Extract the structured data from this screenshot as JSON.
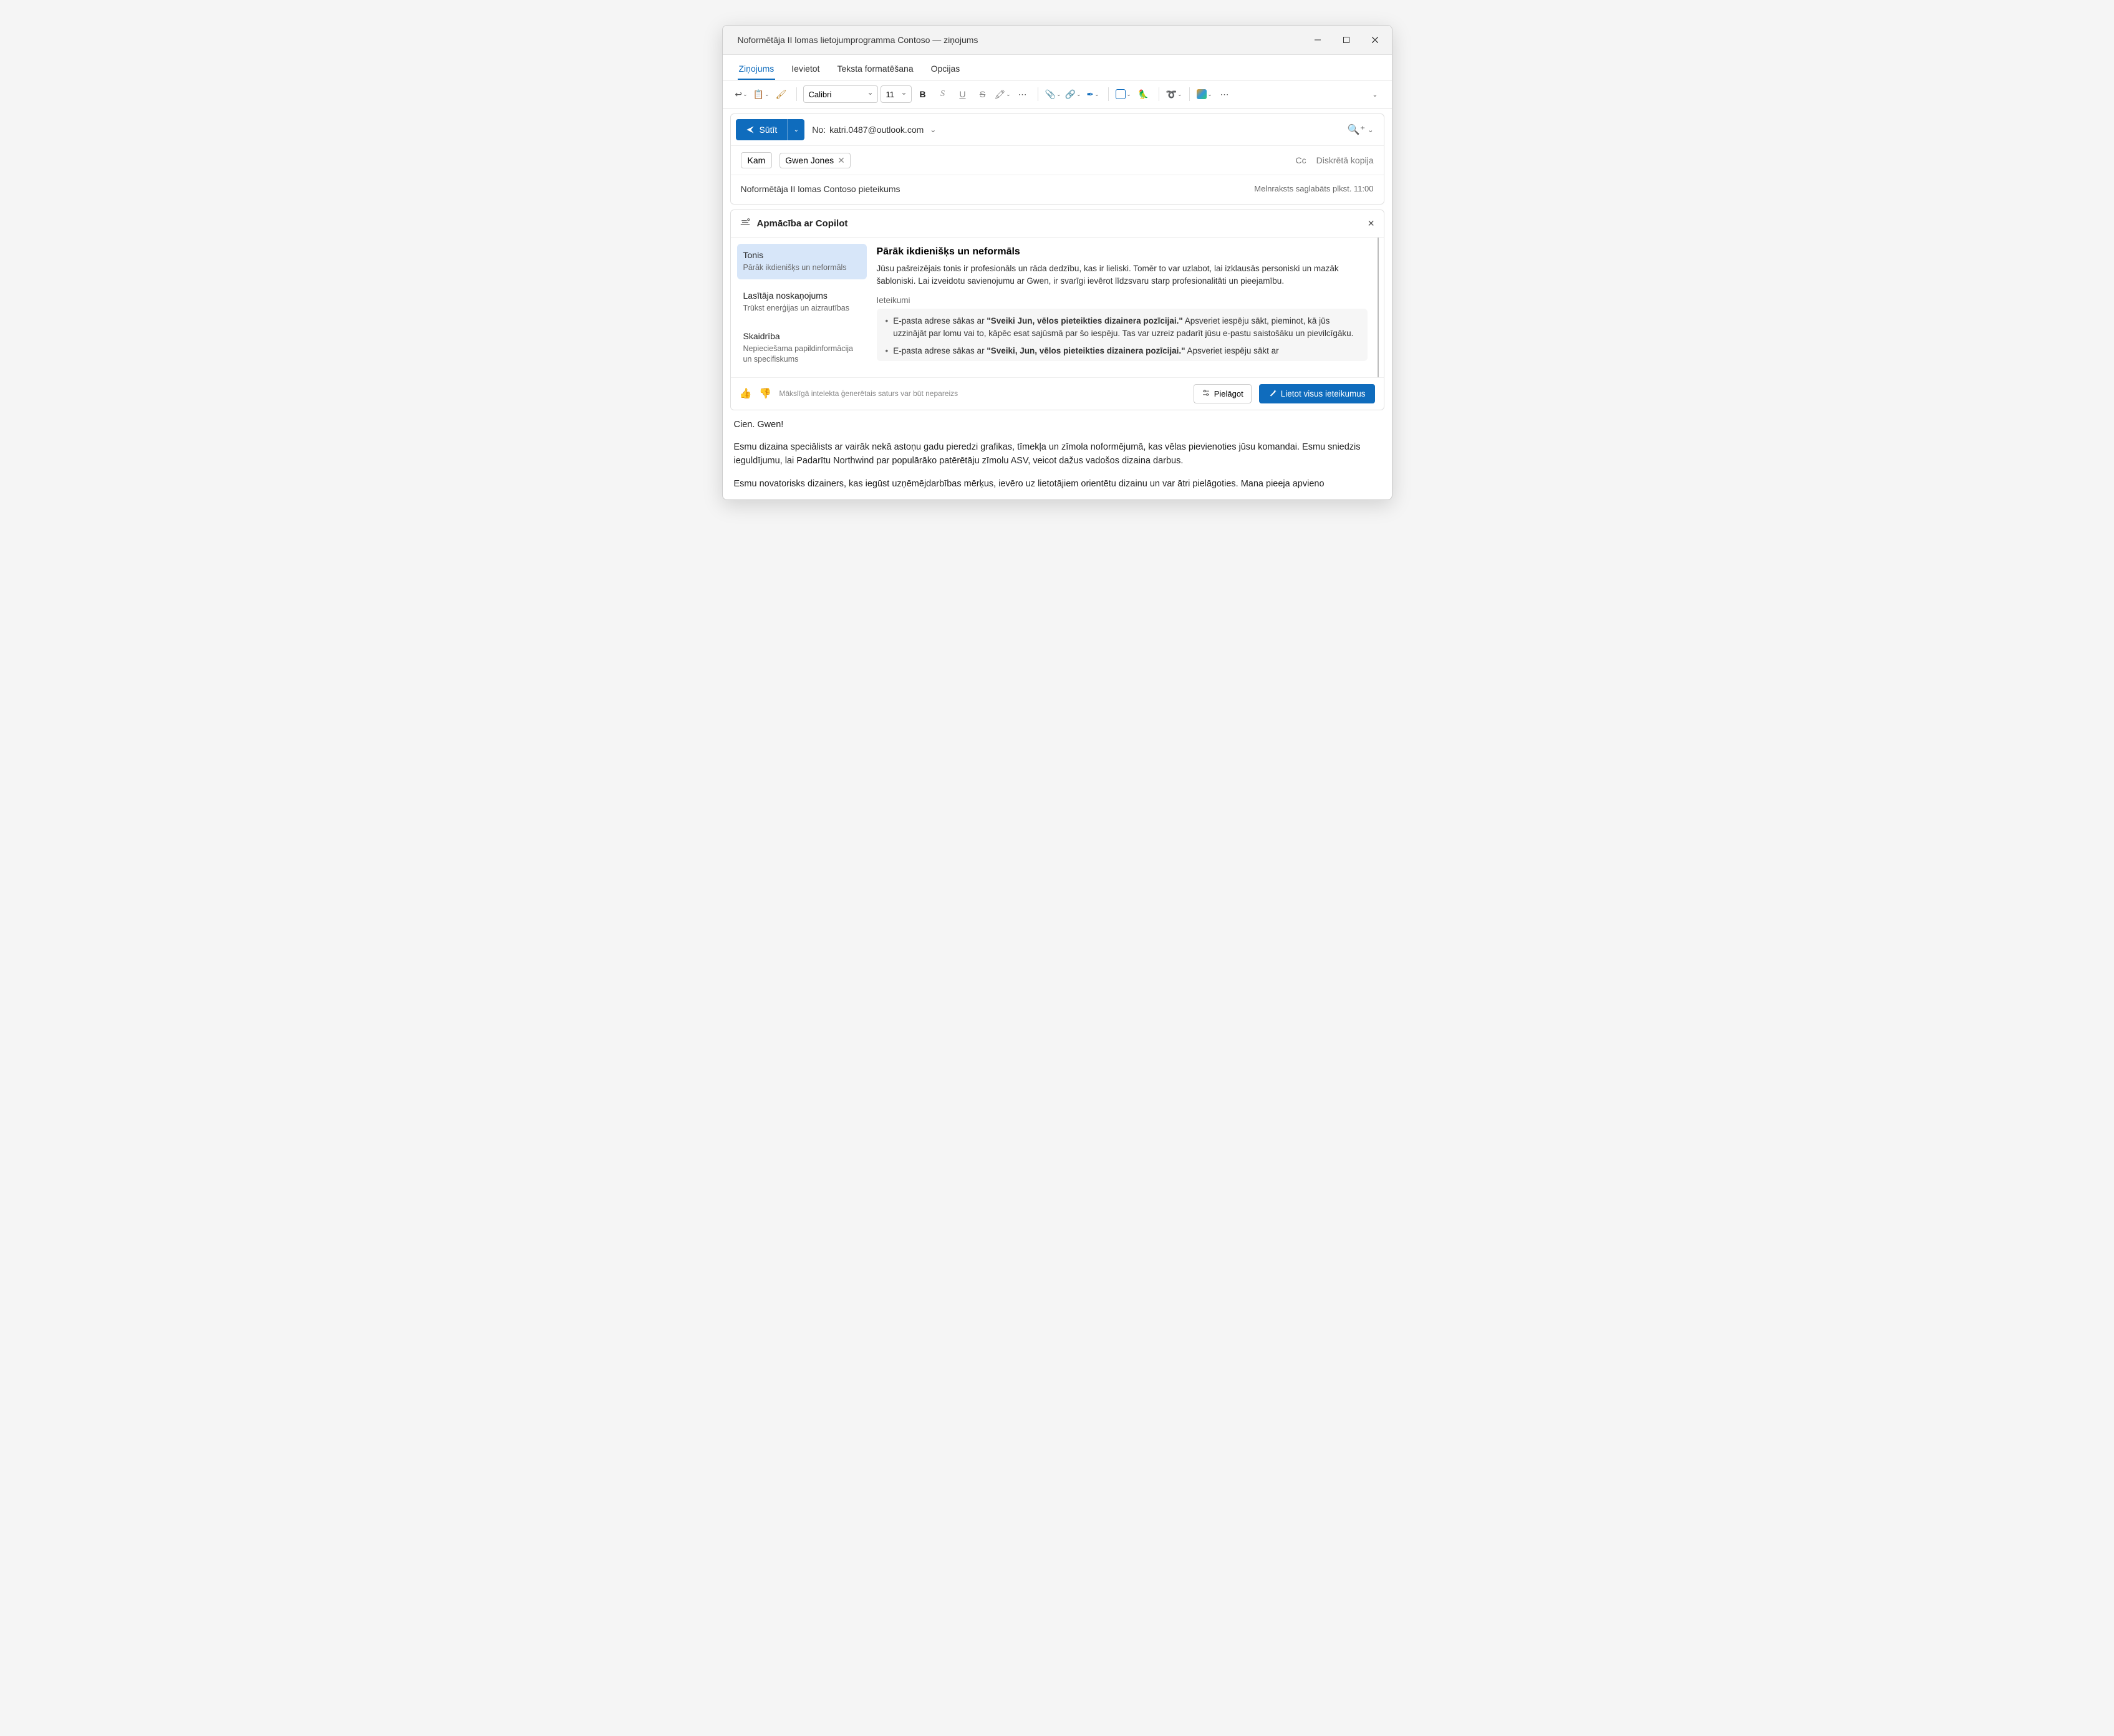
{
  "window": {
    "title": "Noformētāja II lomas lietojumprogramma Contoso — ziņojums"
  },
  "tabs": {
    "message": "Ziņojums",
    "insert": "Ievietot",
    "format": "Teksta formatēšana",
    "options": "Opcijas"
  },
  "ribbon": {
    "font_name": "Calibri",
    "font_size": "11"
  },
  "send": {
    "label": "Sūtīt",
    "from_label": "No:",
    "from_value": "katri.0487@outlook.com"
  },
  "addr": {
    "to_button": "Kam",
    "recipient": "Gwen Jones",
    "cc": "Cc",
    "bcc": "Diskrētā kopija"
  },
  "subject": "Noformētāja II lomas Contoso pieteikums",
  "draft_saved": "Melnraksts saglabāts plkst. 11:00",
  "copilot": {
    "title": "Apmācība ar Copilot",
    "sidebar": [
      {
        "title": "Tonis",
        "sub": "Pārāk ikdienišķs un neformāls"
      },
      {
        "title": "Lasītāja noskaņojums",
        "sub": "Trūkst enerģijas un aizrautības"
      },
      {
        "title": "Skaidrība",
        "sub": "Nepieciešama papildinformācija un specifiskums"
      }
    ],
    "main": {
      "heading": "Pārāk ikdienišķs un neformāls",
      "paragraph": "Jūsu pašreizējais tonis ir profesionāls un rāda dedzību, kas ir lieliski. Tomēr to var uzlabot, lai izklausās personiski un mazāk šabloniski. Lai izveidotu savienojumu ar Gwen, ir svarīgi ievērot līdzsvaru starp profesionalitāti un pieejamību.",
      "sugg_label": "Ieteikumi",
      "sugg1_prefix": "E-pasta adrese sākas ar ",
      "sugg1_quote": "\"Sveiki Jun, vēlos pieteikties dizainera pozīcijai.\"",
      "sugg1_rest": "  Apsveriet iespēju sākt, pieminot, kā jūs uzzinājāt par lomu vai to, kāpēc esat sajūsmā par šo iespēju. Tas var uzreiz padarīt jūsu e-pastu saistošāku un pievilcīgāku.",
      "sugg2_prefix": "E-pasta adrese sākas ar ",
      "sugg2_quote": "\"Sveiki, Jun, vēlos pieteikties dizainera pozīcijai.\"",
      "sugg2_rest": "  Apsveriet iespēju sākt ar"
    },
    "footer": {
      "disclaimer": "Mākslīgā intelekta ģenerētais saturs var būt nepareizs",
      "adjust": "Pielāgot",
      "apply_all": "Lietot visus ieteikumus"
    }
  },
  "body": {
    "greeting": "Cien. Gwen!",
    "p1": "Esmu dizaina speciālists ar vairāk nekā astoņu gadu pieredzi grafikas, tīmekļa un zīmola noformējumā, kas vēlas pievienoties jūsu komandai. Esmu sniedzis ieguldījumu, lai Padarītu Northwind par populārāko patērētāju zīmolu ASV, veicot dažus vadošos dizaina darbus.",
    "p2": "Esmu novatorisks dizainers, kas iegūst uzņēmējdarbības mērķus, ievēro uz lietotājiem orientētu dizainu un var ātri pielāgoties. Mana pieeja apvieno uzņēmējdarbības mērķus ar lietotājam paredzētu noformējumu un pielāgojamību. Esmu priecīgs par to, kā mana aizraušanās ar noformējumu var"
  }
}
